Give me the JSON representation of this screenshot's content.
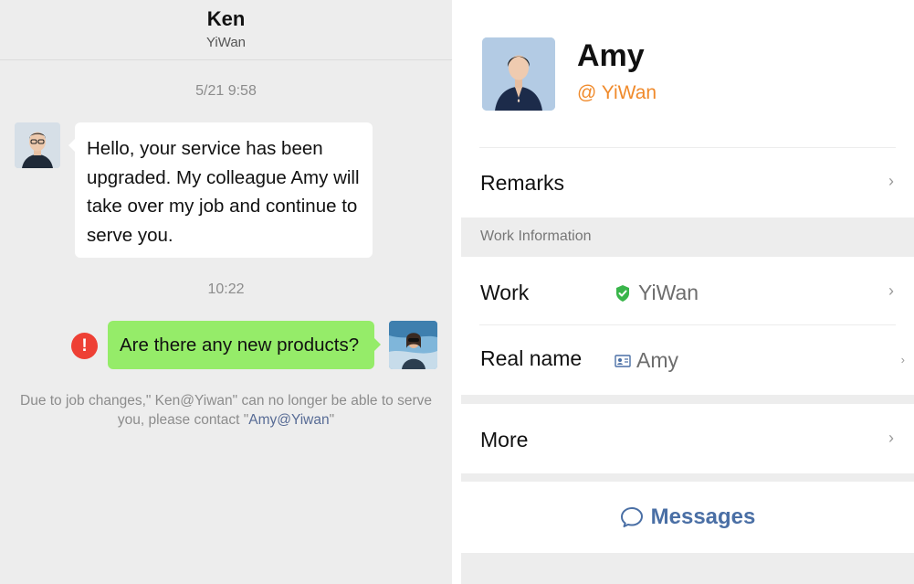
{
  "chat": {
    "title": "Ken",
    "subtitle": "YiWan",
    "messages": [
      {
        "timestamp": "5/21 9:58",
        "text": "Hello, your service has been upgraded. My colleague Amy will take over my job and continue to serve you."
      },
      {
        "timestamp": "10:22",
        "text": "Are there any new products?"
      }
    ],
    "error_symbol": "!",
    "notice_prefix": "Due to job changes,\" Ken@Yiwan\"  can no longer be able to serve you, please contact \"",
    "notice_link": "Amy@Yiwan",
    "notice_suffix": "\""
  },
  "profile": {
    "name": "Amy",
    "corp": "@ YiWan",
    "rows": {
      "remarks": "Remarks",
      "section_title": "Work Information",
      "work_label": "Work",
      "work_value": "YiWan",
      "realname_label": "Real name",
      "realname_value": "Amy",
      "more_label": "More"
    },
    "messages_button": "Messages",
    "chevron": "›"
  },
  "colors": {
    "chat_bg": "#ededed",
    "outgoing_bubble": "#95ec69",
    "error": "#ee4035",
    "corp_orange": "#f08a2b",
    "link_blue": "#576b95",
    "verified_green": "#39b54a",
    "button_blue": "#4a6fa5"
  },
  "icons": {
    "verified": "shield-check-icon",
    "id_card": "id-card-icon",
    "chat": "chat-bubble-icon",
    "chevron": "chevron-right-icon"
  }
}
